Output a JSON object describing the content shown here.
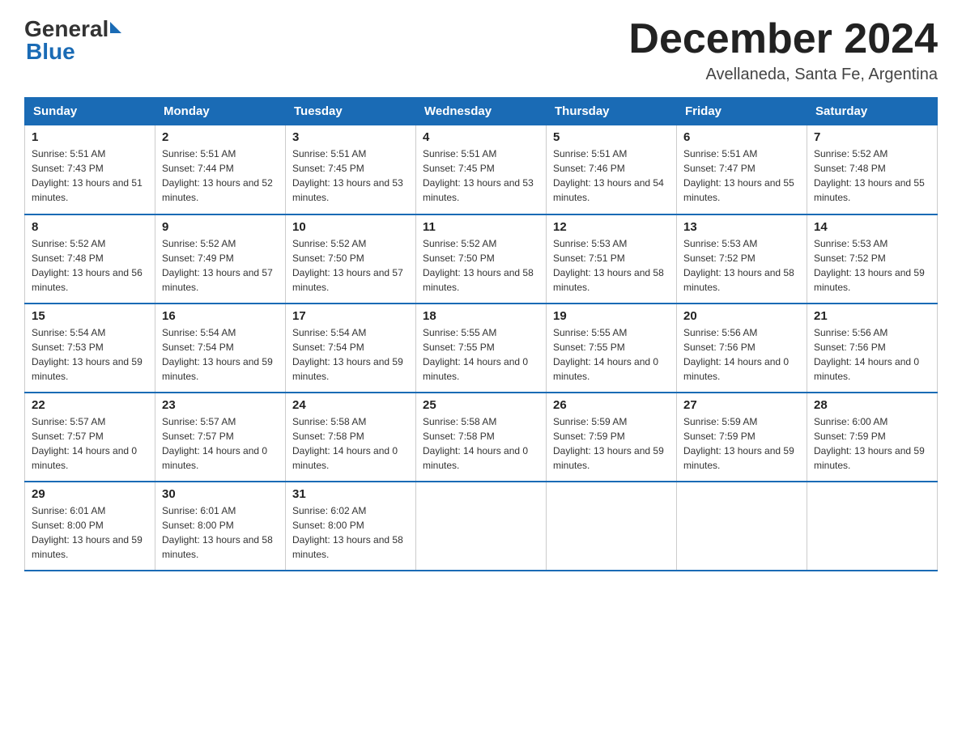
{
  "header": {
    "logo_general": "General",
    "logo_blue": "Blue",
    "month_title": "December 2024",
    "subtitle": "Avellaneda, Santa Fe, Argentina"
  },
  "days_of_week": [
    "Sunday",
    "Monday",
    "Tuesday",
    "Wednesday",
    "Thursday",
    "Friday",
    "Saturday"
  ],
  "weeks": [
    [
      {
        "day": "1",
        "sunrise": "5:51 AM",
        "sunset": "7:43 PM",
        "daylight": "13 hours and 51 minutes."
      },
      {
        "day": "2",
        "sunrise": "5:51 AM",
        "sunset": "7:44 PM",
        "daylight": "13 hours and 52 minutes."
      },
      {
        "day": "3",
        "sunrise": "5:51 AM",
        "sunset": "7:45 PM",
        "daylight": "13 hours and 53 minutes."
      },
      {
        "day": "4",
        "sunrise": "5:51 AM",
        "sunset": "7:45 PM",
        "daylight": "13 hours and 53 minutes."
      },
      {
        "day": "5",
        "sunrise": "5:51 AM",
        "sunset": "7:46 PM",
        "daylight": "13 hours and 54 minutes."
      },
      {
        "day": "6",
        "sunrise": "5:51 AM",
        "sunset": "7:47 PM",
        "daylight": "13 hours and 55 minutes."
      },
      {
        "day": "7",
        "sunrise": "5:52 AM",
        "sunset": "7:48 PM",
        "daylight": "13 hours and 55 minutes."
      }
    ],
    [
      {
        "day": "8",
        "sunrise": "5:52 AM",
        "sunset": "7:48 PM",
        "daylight": "13 hours and 56 minutes."
      },
      {
        "day": "9",
        "sunrise": "5:52 AM",
        "sunset": "7:49 PM",
        "daylight": "13 hours and 57 minutes."
      },
      {
        "day": "10",
        "sunrise": "5:52 AM",
        "sunset": "7:50 PM",
        "daylight": "13 hours and 57 minutes."
      },
      {
        "day": "11",
        "sunrise": "5:52 AM",
        "sunset": "7:50 PM",
        "daylight": "13 hours and 58 minutes."
      },
      {
        "day": "12",
        "sunrise": "5:53 AM",
        "sunset": "7:51 PM",
        "daylight": "13 hours and 58 minutes."
      },
      {
        "day": "13",
        "sunrise": "5:53 AM",
        "sunset": "7:52 PM",
        "daylight": "13 hours and 58 minutes."
      },
      {
        "day": "14",
        "sunrise": "5:53 AM",
        "sunset": "7:52 PM",
        "daylight": "13 hours and 59 minutes."
      }
    ],
    [
      {
        "day": "15",
        "sunrise": "5:54 AM",
        "sunset": "7:53 PM",
        "daylight": "13 hours and 59 minutes."
      },
      {
        "day": "16",
        "sunrise": "5:54 AM",
        "sunset": "7:54 PM",
        "daylight": "13 hours and 59 minutes."
      },
      {
        "day": "17",
        "sunrise": "5:54 AM",
        "sunset": "7:54 PM",
        "daylight": "13 hours and 59 minutes."
      },
      {
        "day": "18",
        "sunrise": "5:55 AM",
        "sunset": "7:55 PM",
        "daylight": "14 hours and 0 minutes."
      },
      {
        "day": "19",
        "sunrise": "5:55 AM",
        "sunset": "7:55 PM",
        "daylight": "14 hours and 0 minutes."
      },
      {
        "day": "20",
        "sunrise": "5:56 AM",
        "sunset": "7:56 PM",
        "daylight": "14 hours and 0 minutes."
      },
      {
        "day": "21",
        "sunrise": "5:56 AM",
        "sunset": "7:56 PM",
        "daylight": "14 hours and 0 minutes."
      }
    ],
    [
      {
        "day": "22",
        "sunrise": "5:57 AM",
        "sunset": "7:57 PM",
        "daylight": "14 hours and 0 minutes."
      },
      {
        "day": "23",
        "sunrise": "5:57 AM",
        "sunset": "7:57 PM",
        "daylight": "14 hours and 0 minutes."
      },
      {
        "day": "24",
        "sunrise": "5:58 AM",
        "sunset": "7:58 PM",
        "daylight": "14 hours and 0 minutes."
      },
      {
        "day": "25",
        "sunrise": "5:58 AM",
        "sunset": "7:58 PM",
        "daylight": "14 hours and 0 minutes."
      },
      {
        "day": "26",
        "sunrise": "5:59 AM",
        "sunset": "7:59 PM",
        "daylight": "13 hours and 59 minutes."
      },
      {
        "day": "27",
        "sunrise": "5:59 AM",
        "sunset": "7:59 PM",
        "daylight": "13 hours and 59 minutes."
      },
      {
        "day": "28",
        "sunrise": "6:00 AM",
        "sunset": "7:59 PM",
        "daylight": "13 hours and 59 minutes."
      }
    ],
    [
      {
        "day": "29",
        "sunrise": "6:01 AM",
        "sunset": "8:00 PM",
        "daylight": "13 hours and 59 minutes."
      },
      {
        "day": "30",
        "sunrise": "6:01 AM",
        "sunset": "8:00 PM",
        "daylight": "13 hours and 58 minutes."
      },
      {
        "day": "31",
        "sunrise": "6:02 AM",
        "sunset": "8:00 PM",
        "daylight": "13 hours and 58 minutes."
      },
      null,
      null,
      null,
      null
    ]
  ]
}
